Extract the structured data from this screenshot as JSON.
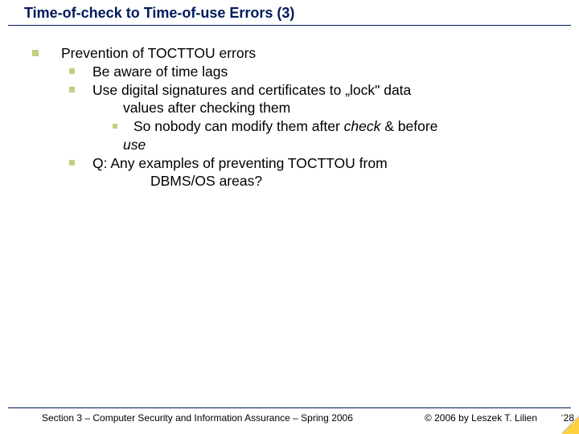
{
  "title": "Time-of-check to Time-of-use Errors (3)",
  "lines": {
    "l1": "Prevention of TOCTTOU errors",
    "l2": "Be aware of time lags",
    "l3a": "Use digital signatures and certificates to „lock\" data",
    "l3b": "values after checking them",
    "l4a": "So nobody can modify them after ",
    "l4b": "check",
    "l4c": " & before",
    "l4d": "use",
    "l5a": "Q:  Any examples of preventing TOCTTOU from",
    "l5b": "DBMS/OS areas?"
  },
  "footer": {
    "left": "Section 3 – Computer Security and Information Assurance – Spring 2006",
    "right": "© 2006 by Leszek T. Lilien"
  },
  "pagenum": "28"
}
